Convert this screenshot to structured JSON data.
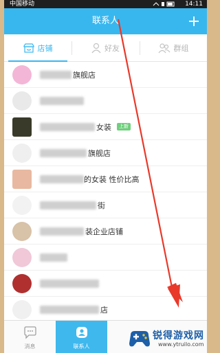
{
  "status_bar": {
    "carrier": "中国移动",
    "time": "14:11"
  },
  "header": {
    "title": "联系人",
    "plus_icon": "plus-icon"
  },
  "tabs": [
    {
      "label": "店铺",
      "icon": "shop-icon",
      "active": true
    },
    {
      "label": "好友",
      "icon": "person-icon",
      "active": false
    },
    {
      "label": "群组",
      "icon": "group-icon",
      "active": false
    }
  ],
  "contacts": [
    {
      "name_suffix": "旗舰店",
      "badge": "",
      "avatar_color": "#f3b6d6"
    },
    {
      "name_suffix": "",
      "badge": "",
      "avatar_color": "#e9e9e9"
    },
    {
      "name_suffix": "女装",
      "badge": "上新",
      "avatar_color": "#3a3a2a"
    },
    {
      "name_suffix": "旗舰店",
      "badge": "",
      "avatar_color": "#efefef"
    },
    {
      "name_suffix": "的女装 性价比高",
      "badge": "",
      "avatar_color": "#e8b8a0"
    },
    {
      "name_suffix": "街",
      "badge": "",
      "avatar_color": "#f2f2f2"
    },
    {
      "name_suffix": "装企业店铺",
      "badge": "",
      "avatar_color": "#d8c2a8"
    },
    {
      "name_suffix": "",
      "badge": "",
      "avatar_color": "#f0c8d8"
    },
    {
      "name_suffix": "",
      "badge": "",
      "avatar_color": "#b03030"
    },
    {
      "name_suffix": "店",
      "badge": "",
      "avatar_color": "#f0f0f0"
    }
  ],
  "bottom_nav": [
    {
      "label": "消息",
      "icon": "chat-bubble-icon",
      "active": false
    },
    {
      "label": "联系人",
      "icon": "contacts-icon",
      "active": true
    }
  ],
  "watermark": {
    "title": "锐得游戏网",
    "url": "www.ytruilo.com"
  },
  "colors": {
    "accent": "#38b7ef",
    "annotation_arrow": "#e8392a"
  }
}
